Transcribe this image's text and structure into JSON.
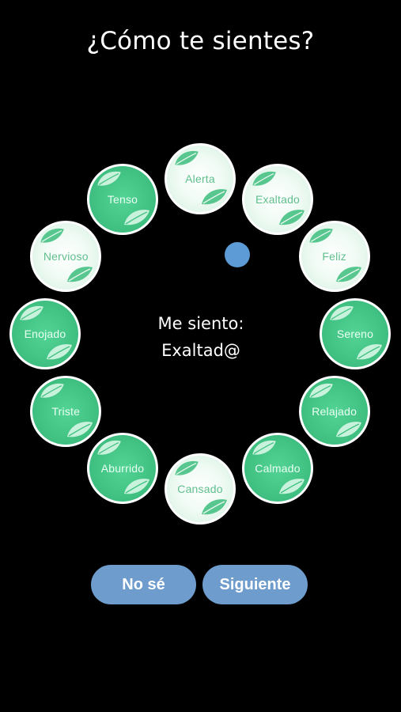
{
  "header": {
    "title": "¿Cómo te sientes?"
  },
  "wheel": {
    "emotions": [
      {
        "label": "Alerta",
        "style": "light",
        "angle": 0
      },
      {
        "label": "Exaltado",
        "style": "light",
        "angle": 30
      },
      {
        "label": "Feliz",
        "style": "light",
        "angle": 60
      },
      {
        "label": "Sereno",
        "style": "dark",
        "angle": 90
      },
      {
        "label": "Relajado",
        "style": "dark",
        "angle": 120
      },
      {
        "label": "Calmado",
        "style": "dark",
        "angle": 150
      },
      {
        "label": "Cansado",
        "style": "light",
        "angle": 180
      },
      {
        "label": "Aburrido",
        "style": "dark",
        "angle": 210
      },
      {
        "label": "Triste",
        "style": "dark",
        "angle": 240
      },
      {
        "label": "Enojado",
        "style": "dark",
        "angle": 270
      },
      {
        "label": "Nervioso",
        "style": "light",
        "angle": 300
      },
      {
        "label": "Tenso",
        "style": "dark",
        "angle": 330
      }
    ],
    "selected_index": 1
  },
  "center": {
    "prompt": "Me siento:",
    "value": "Exaltad@"
  },
  "buttons": {
    "dont_know": "No sé",
    "next": "Siguiente"
  },
  "colors": {
    "background": "#000000",
    "green_dark": "#41c283",
    "green_light": "#d3f0df",
    "indicator": "#5d9bd6",
    "button": "#6e9ccc"
  }
}
